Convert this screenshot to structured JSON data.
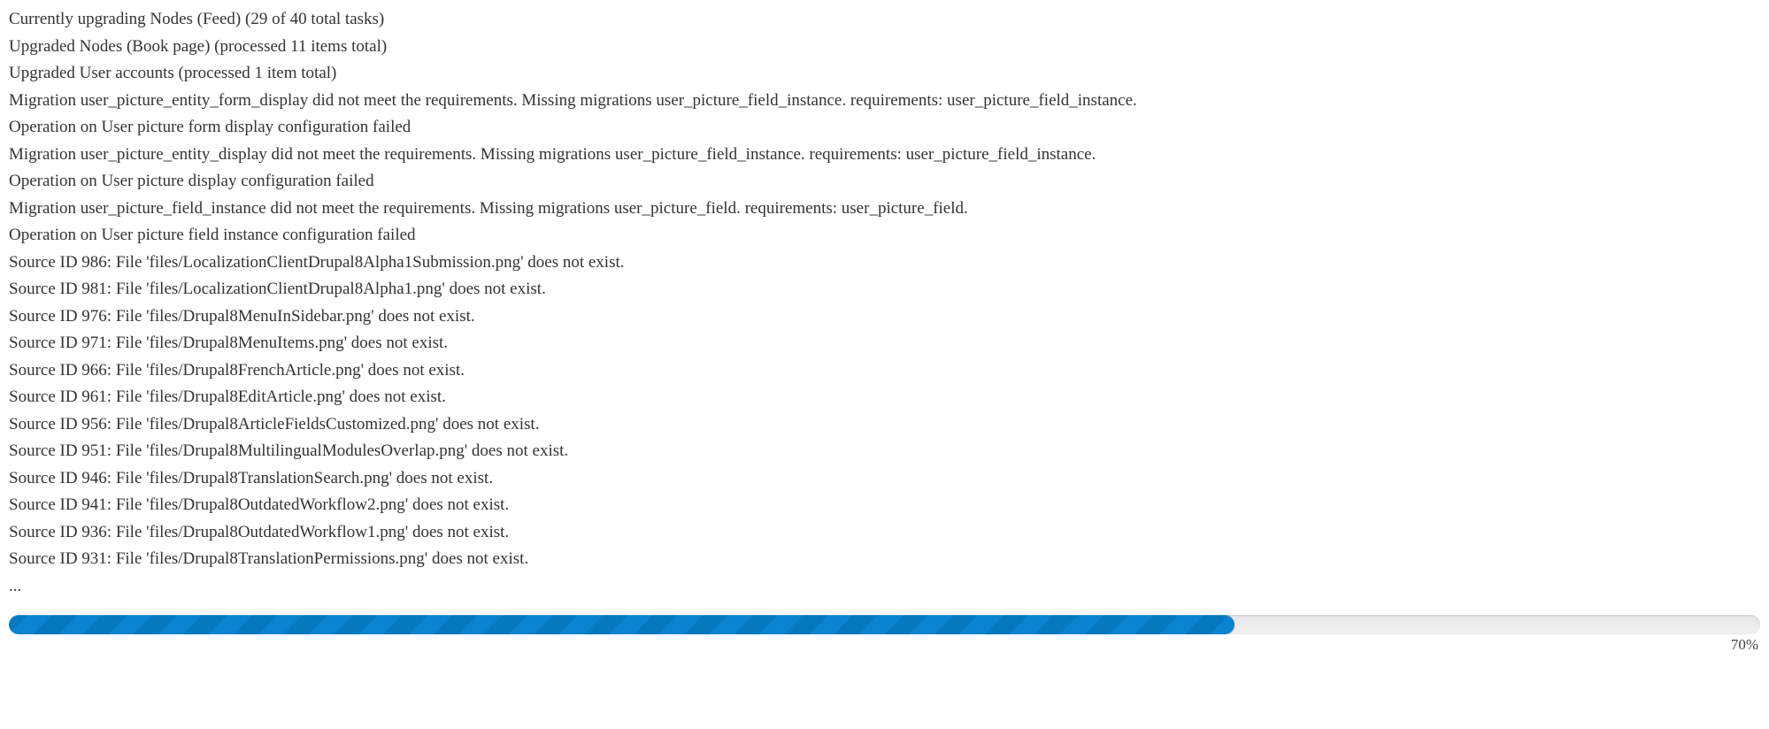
{
  "messages": [
    "Currently upgrading Nodes (Feed) (29 of 40 total tasks)",
    "Upgraded Nodes (Book page) (processed 11 items total)",
    "Upgraded User accounts (processed 1 item total)",
    "Migration user_picture_entity_form_display did not meet the requirements. Missing migrations user_picture_field_instance. requirements: user_picture_field_instance.",
    "Operation on User picture form display configuration failed",
    "Migration user_picture_entity_display did not meet the requirements. Missing migrations user_picture_field_instance. requirements: user_picture_field_instance.",
    "Operation on User picture display configuration failed",
    "Migration user_picture_field_instance did not meet the requirements. Missing migrations user_picture_field. requirements: user_picture_field.",
    "Operation on User picture field instance configuration failed",
    "Source ID 986: File 'files/LocalizationClientDrupal8Alpha1Submission.png' does not exist.",
    "Source ID 981: File 'files/LocalizationClientDrupal8Alpha1.png' does not exist.",
    "Source ID 976: File 'files/Drupal8MenuInSidebar.png' does not exist.",
    "Source ID 971: File 'files/Drupal8MenuItems.png' does not exist.",
    "Source ID 966: File 'files/Drupal8FrenchArticle.png' does not exist.",
    "Source ID 961: File 'files/Drupal8EditArticle.png' does not exist.",
    "Source ID 956: File 'files/Drupal8ArticleFieldsCustomized.png' does not exist.",
    "Source ID 951: File 'files/Drupal8MultilingualModulesOverlap.png' does not exist.",
    "Source ID 946: File 'files/Drupal8TranslationSearch.png' does not exist.",
    "Source ID 941: File 'files/Drupal8OutdatedWorkflow2.png' does not exist.",
    "Source ID 936: File 'files/Drupal8OutdatedWorkflow1.png' does not exist.",
    "Source ID 931: File 'files/Drupal8TranslationPermissions.png' does not exist.",
    "..."
  ],
  "progress": {
    "percent": 70,
    "label": "70%",
    "widthStyle": "width:70%"
  }
}
